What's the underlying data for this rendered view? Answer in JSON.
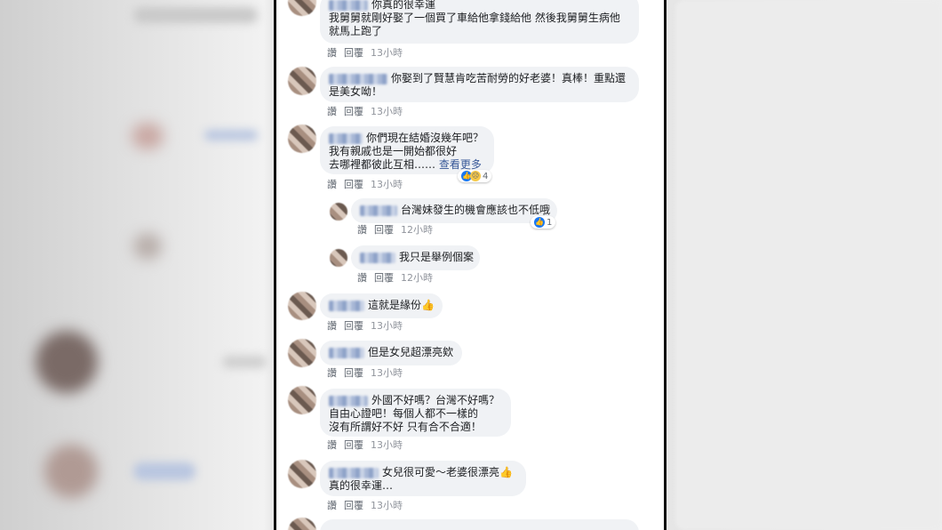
{
  "actions": {
    "like": "讚",
    "reply": "回覆"
  },
  "reaction_icons": {
    "like": "thumbs-up-icon",
    "sad": "sad-face-icon"
  },
  "comments": [
    {
      "lines": [
        "你真的很幸運",
        "我舅舅就剛好娶了一個買了車給他拿錢給他 然後我舅舅生病他",
        "就馬上跑了"
      ],
      "time": "13小時"
    },
    {
      "lines": [
        "你娶到了賢慧肯吃苦耐勞的好老婆！真棒！重點還",
        "是美女呦！"
      ],
      "time": "13小時"
    },
    {
      "lines": [
        "你們現在結婚沒幾年吧？",
        "我有親戚也是一開始都很好",
        "去哪裡都彼此互相……"
      ],
      "more": "查看更多",
      "time": "13小時",
      "reaction_count": "4"
    },
    {
      "lines": [
        "台灣妹發生的機會應該也不低哦"
      ],
      "time": "12小時",
      "reaction_count": "1"
    },
    {
      "lines": [
        "我只是舉例個案"
      ],
      "time": "12小時"
    },
    {
      "lines": [
        "這就是緣份👍"
      ],
      "time": "13小時"
    },
    {
      "lines": [
        "但是女兒超漂亮欸"
      ],
      "time": "13小時"
    },
    {
      "lines": [
        "外國不好嗎？台灣不好嗎？",
        "自由心證吧！每個人都不一樣的",
        "沒有所謂好不好 只有合不合適！"
      ],
      "time": "13小時"
    },
    {
      "lines": [
        "女兒很可愛～老婆很漂亮👍",
        "真的很幸運…"
      ],
      "time": "13小時"
    }
  ]
}
